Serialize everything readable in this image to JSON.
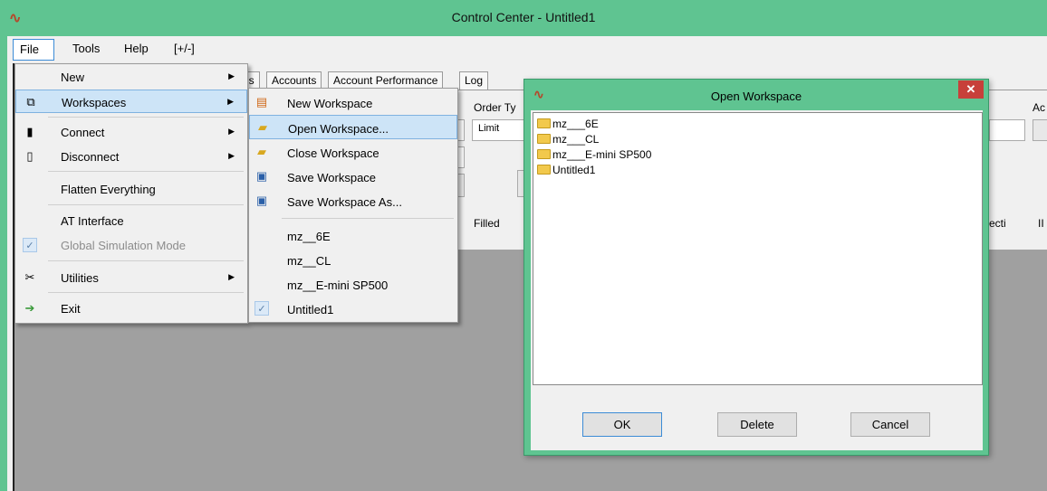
{
  "window": {
    "title": "Control Center - Untitled1",
    "logo_icon": "app-logo-icon"
  },
  "menubar": {
    "file": "File",
    "tools": "Tools",
    "help": "Help",
    "toggle": "[+/-]"
  },
  "tabs": [
    "ns",
    "Accounts",
    "Account Performance",
    "Log"
  ],
  "order_panel": {
    "order_type_label": "Order Ty",
    "order_type_value": "Limit",
    "ac_label": "Ac"
  },
  "grid": {
    "filled_header": "Filled",
    "col_directi": "ecti",
    "col_ii": "II"
  },
  "file_menu": {
    "items": [
      {
        "label": "New",
        "icon": "",
        "submenu": true
      },
      {
        "label": "Workspaces",
        "icon": "workspaces-icon",
        "submenu": true
      },
      {
        "label": "Connect",
        "icon": "plug-connect-icon",
        "submenu": true
      },
      {
        "label": "Disconnect",
        "icon": "plug-disconnect-icon",
        "submenu": true
      },
      {
        "label": "Flatten Everything",
        "icon": "",
        "submenu": false
      },
      {
        "label": "AT Interface",
        "icon": "",
        "submenu": false
      },
      {
        "label": "Global Simulation Mode",
        "icon": "checkmark-icon",
        "submenu": false,
        "disabled": true
      },
      {
        "label": "Utilities",
        "icon": "tools-icon",
        "submenu": true
      },
      {
        "label": "Exit",
        "icon": "exit-icon",
        "submenu": false
      }
    ]
  },
  "workspaces_menu": {
    "items": [
      {
        "label": "New Workspace",
        "icon": "new-workspace-icon"
      },
      {
        "label": "Open Workspace...",
        "icon": "open-folder-icon"
      },
      {
        "label": "Close Workspace",
        "icon": "close-folder-icon"
      },
      {
        "label": "Save Workspace",
        "icon": "save-icon"
      },
      {
        "label": "Save Workspace As...",
        "icon": "save-as-icon"
      }
    ],
    "recent": [
      {
        "label": "mz__6E",
        "checked": false
      },
      {
        "label": "mz__CL",
        "checked": false
      },
      {
        "label": "mz__E-mini SP500",
        "checked": false
      },
      {
        "label": "Untitled1",
        "checked": true
      }
    ]
  },
  "dialog": {
    "title": "Open Workspace",
    "close": "✕",
    "workspaces": [
      "mz___6E",
      "mz___CL",
      "mz___E-mini SP500",
      "Untitled1"
    ],
    "ok": "OK",
    "delete": "Delete",
    "cancel": "Cancel"
  }
}
